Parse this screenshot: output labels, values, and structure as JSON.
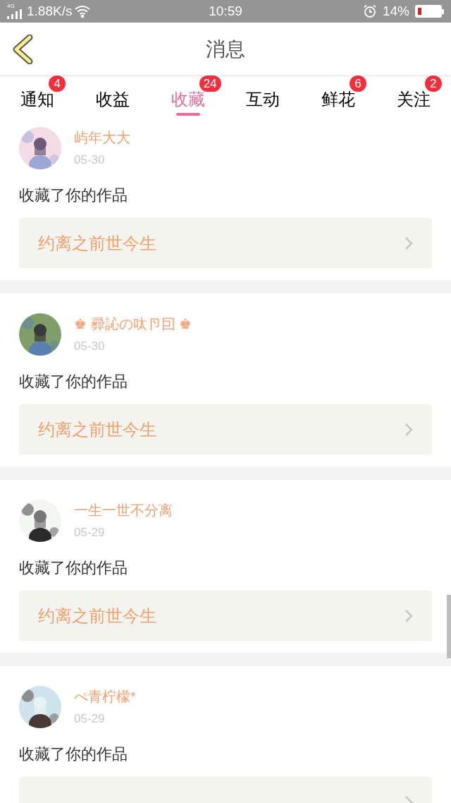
{
  "status_bar": {
    "network": "4G",
    "speed": "1.88K/s",
    "time": "10:59",
    "battery": "14%"
  },
  "header": {
    "title": "消息"
  },
  "tabs": [
    {
      "label": "通知",
      "badge": "4",
      "selected": false
    },
    {
      "label": "收益",
      "selected": false
    },
    {
      "label": "收藏",
      "badge": "24",
      "selected": true
    },
    {
      "label": "互动",
      "selected": false
    },
    {
      "label": "鲜花",
      "badge": "6",
      "selected": false
    },
    {
      "label": "关注",
      "badge": "2",
      "selected": false
    }
  ],
  "items": [
    {
      "name": "屿年大大",
      "date": "05-30",
      "action": "收藏了你的作品",
      "work": "约离之前世今生"
    },
    {
      "name": "♚ 彛訫の呔卪囙 ♚",
      "date": "05-30",
      "action": "收藏了你的作品",
      "work": "约离之前世今生"
    },
    {
      "name": "一生一世不分离",
      "date": "05-29",
      "action": "收藏了你的作品",
      "work": "约离之前世今生"
    },
    {
      "name": "ぺ青柠檬*",
      "date": "05-29",
      "action": "收藏了你的作品"
    }
  ]
}
